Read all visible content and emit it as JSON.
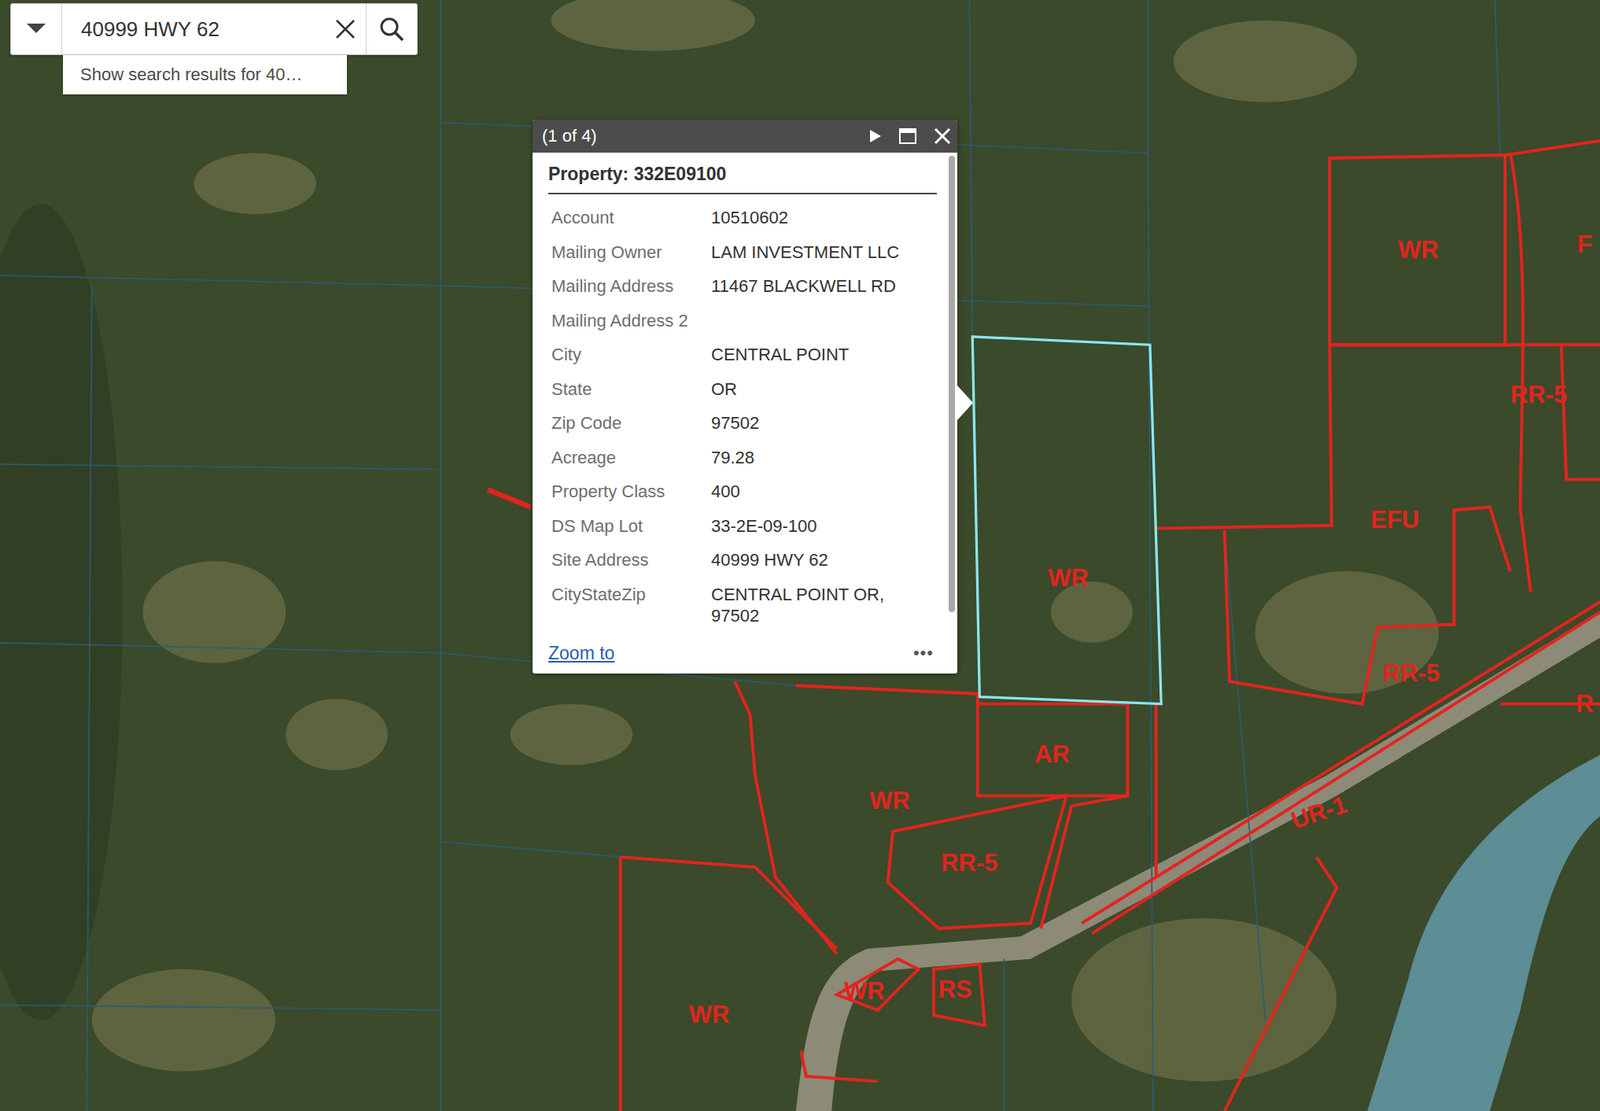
{
  "search": {
    "value": "40999 HWY 62",
    "suggestion": "Show search results for 40…"
  },
  "popup": {
    "counter": "(1 of 4)",
    "title": "Property: 332E09100",
    "fields": [
      {
        "label": "Account",
        "value": "10510602"
      },
      {
        "label": "Mailing Owner",
        "value": "LAM INVESTMENT LLC"
      },
      {
        "label": "Mailing Address",
        "value": "11467 BLACKWELL RD"
      },
      {
        "label": "Mailing Address 2",
        "value": ""
      },
      {
        "label": "City",
        "value": "CENTRAL POINT"
      },
      {
        "label": "State",
        "value": "OR"
      },
      {
        "label": "Zip Code",
        "value": "97502"
      },
      {
        "label": "Acreage",
        "value": "79.28"
      },
      {
        "label": "Property Class",
        "value": "400"
      },
      {
        "label": "DS Map Lot",
        "value": "33-2E-09-100"
      },
      {
        "label": "Site Address",
        "value": "40999 HWY 62"
      },
      {
        "label": "CityStateZip",
        "value": "CENTRAL POINT OR, 97502"
      }
    ],
    "zoom_link": "Zoom to",
    "more": "•••"
  },
  "map": {
    "zones": [
      {
        "label": "WR"
      },
      {
        "label": "F"
      },
      {
        "label": "RR-5"
      },
      {
        "label": "EFU"
      },
      {
        "label": "RR-5"
      },
      {
        "label": "R"
      },
      {
        "label": "WR",
        "selected": true
      },
      {
        "label": "AR"
      },
      {
        "label": "WR"
      },
      {
        "label": "RR-5"
      },
      {
        "label": "UR-1"
      },
      {
        "label": "WR"
      },
      {
        "label": "RS"
      },
      {
        "label": "WR"
      }
    ]
  }
}
